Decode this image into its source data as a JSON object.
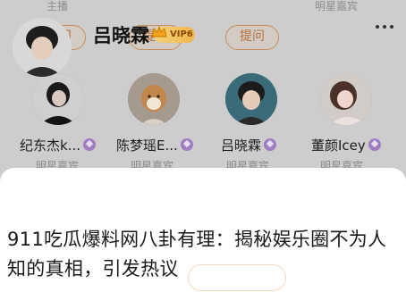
{
  "top_labels": [
    "主播",
    "明星嘉宾"
  ],
  "ask_label": "提问",
  "people": [
    {
      "name": "纪东杰k...",
      "role": "明星嘉宾"
    },
    {
      "name": "陈梦瑶E...",
      "role": "明星嘉宾"
    },
    {
      "name": "吕晓霖",
      "role": "明星嘉宾"
    },
    {
      "name": "董颜Icey",
      "role": "明星嘉宾"
    }
  ],
  "sheet": {
    "name": "吕晓霖",
    "badge": "VIP6"
  },
  "headline": "911吃瓜爆料网八卦有理：揭秘娱乐圈不为人知的真相，引发热议",
  "colors": {
    "accent": "#c8905a",
    "verified": "#a07cc0",
    "vip": "#f2b54c"
  }
}
